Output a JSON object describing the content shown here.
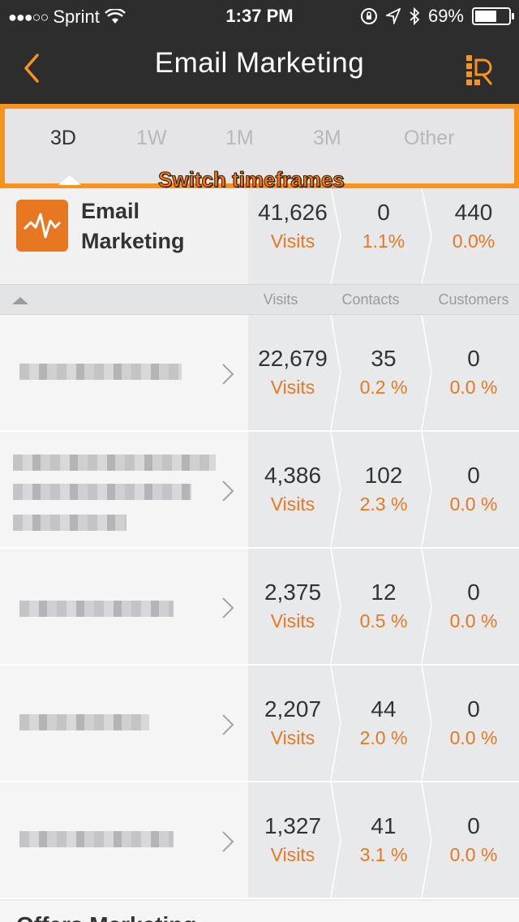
{
  "status_bar": {
    "carrier": "Sprint",
    "time": "1:37 PM",
    "battery": "69%",
    "signal": "●●●○○"
  },
  "nav": {
    "title": "Email Marketing",
    "back_icon": "chevron-left-icon",
    "report_icon": "report-icon"
  },
  "accent": "#e87722",
  "highlight_border": "#f7941e",
  "timeframes": {
    "tabs": [
      "3D",
      "1W",
      "1M",
      "3M",
      "Other"
    ],
    "active": "3D",
    "annotation": "Switch timeframes"
  },
  "summary": {
    "name_line1": "Email",
    "name_line2": "Marketing",
    "visits": "41,626",
    "visits_label": "Visits",
    "contacts": "0",
    "contacts_rate": "1.1%",
    "customers": "440",
    "customers_rate": "0.0%"
  },
  "columns": [
    "Visits",
    "Contacts",
    "Customers"
  ],
  "rows": [
    {
      "visits": "22,679",
      "visits_label": "Visits",
      "contacts": "35",
      "contacts_rate": "0.2 %",
      "customers": "0",
      "customers_rate": "0.0 %"
    },
    {
      "visits": "4,386",
      "visits_label": "Visits",
      "contacts": "102",
      "contacts_rate": "2.3 %",
      "customers": "0",
      "customers_rate": "0.0 %"
    },
    {
      "visits": "2,375",
      "visits_label": "Visits",
      "contacts": "12",
      "contacts_rate": "0.5 %",
      "customers": "0",
      "customers_rate": "0.0 %"
    },
    {
      "visits": "2,207",
      "visits_label": "Visits",
      "contacts": "44",
      "contacts_rate": "2.0 %",
      "customers": "0",
      "customers_rate": "0.0 %"
    },
    {
      "visits": "1,327",
      "visits_label": "Visits",
      "contacts": "41",
      "contacts_rate": "3.1 %",
      "customers": "0",
      "customers_rate": "0.0 %"
    }
  ],
  "next_section": "Offers Marketing"
}
